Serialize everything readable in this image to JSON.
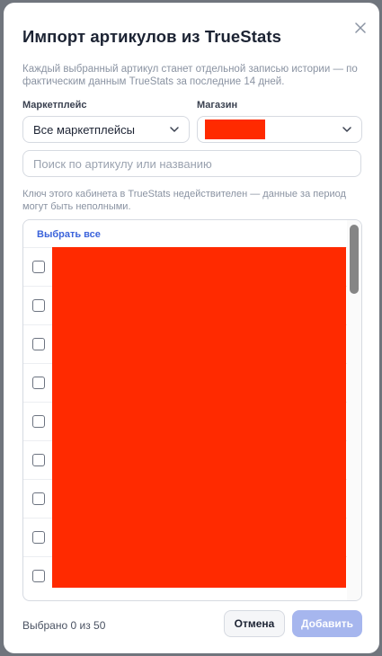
{
  "modal": {
    "title": "Импорт артикулов из TrueStats",
    "description": "Каждый выбранный артикул станет отдельной записью истории — по фактическим данным TrueStats за последние 14 дней.",
    "marketplace_label": "Маркетплейс",
    "marketplace_value": "Все маркетплейсы",
    "store_label": "Магазин",
    "search_placeholder": "Поиск по артикулу или названию",
    "warning": "Ключ этого кабинета в TrueStats недействителен — данные за период могут быть неполными.",
    "select_all": "Выбрать все",
    "selected_count": "Выбрано 0 из 50",
    "cancel_label": "Отмена",
    "add_label": "Добавить"
  },
  "colors": {
    "accent": "#3b63db",
    "add_button_disabled": "#a6b6ee",
    "redaction": "#ff2a00"
  },
  "icons": {
    "close": "close-icon",
    "chevron": "chevron-down-icon"
  }
}
